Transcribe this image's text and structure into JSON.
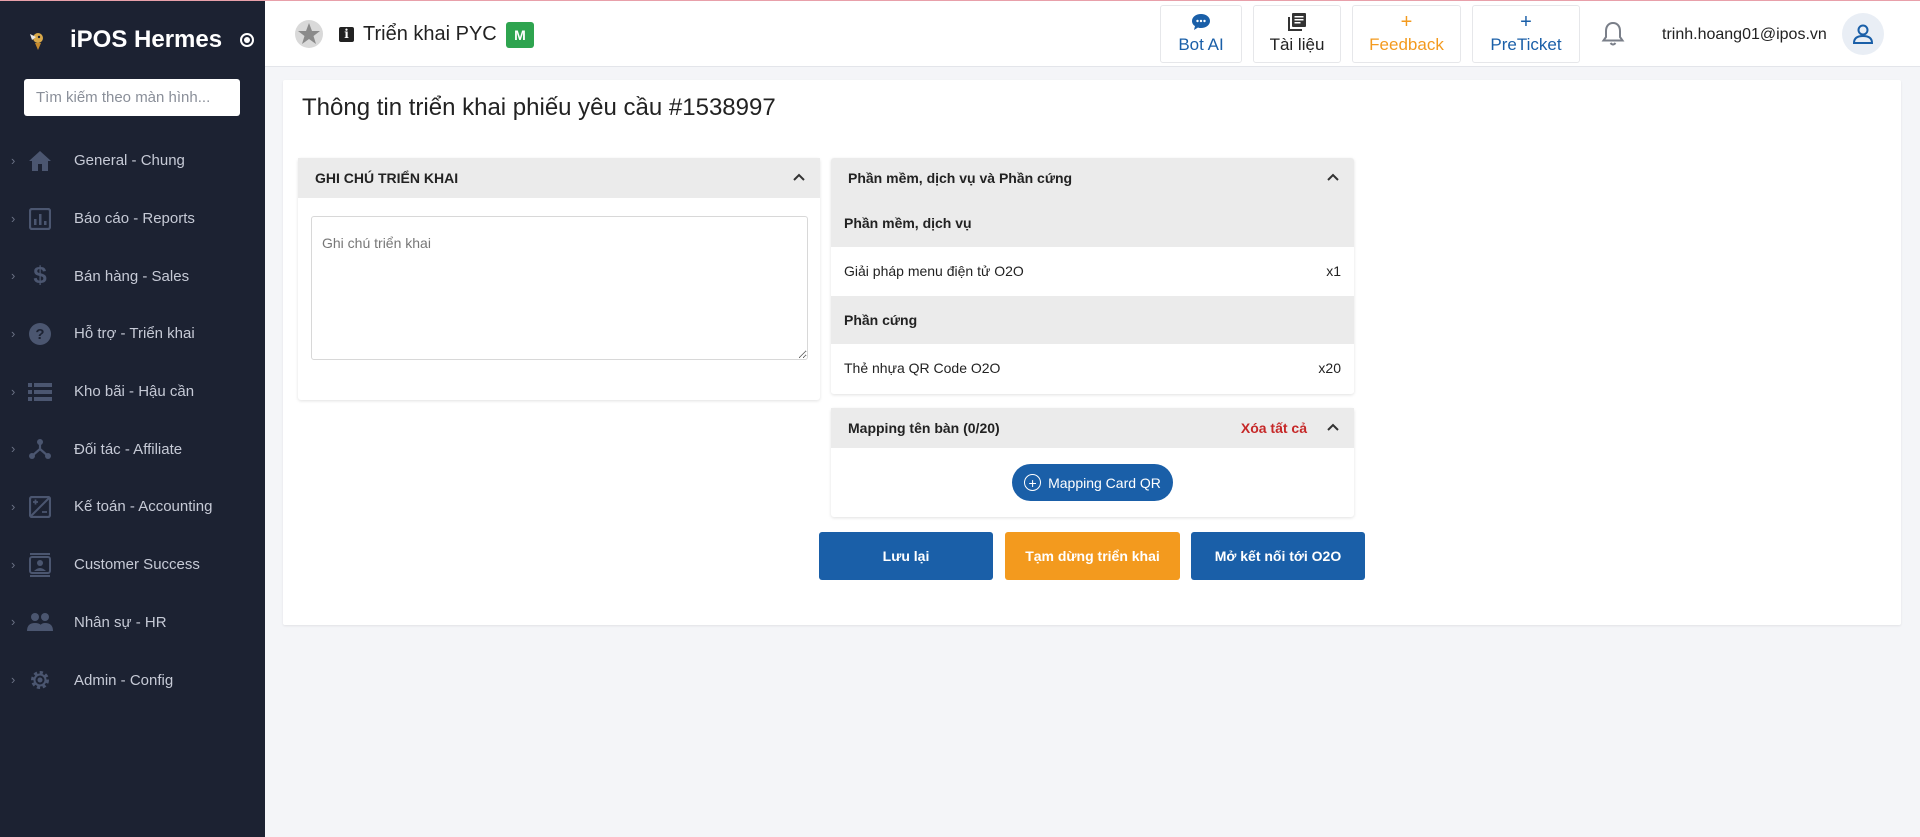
{
  "sidebar": {
    "brand": "iPOS Hermes",
    "search_placeholder": "Tìm kiếm theo màn hình...",
    "items": [
      {
        "label": "General - Chung",
        "icon": "home-icon"
      },
      {
        "label": "Báo cáo - Reports",
        "icon": "report-chart-icon"
      },
      {
        "label": "Bán hàng - Sales",
        "icon": "dollar-icon"
      },
      {
        "label": "Hỗ trợ - Triển khai",
        "icon": "help-circle-icon"
      },
      {
        "label": "Kho bãi - Hậu cần",
        "icon": "list-stack-icon"
      },
      {
        "label": "Đối tác - Affiliate",
        "icon": "network-hub-icon"
      },
      {
        "label": "Kế toán - Accounting",
        "icon": "calculator-icon"
      },
      {
        "label": "Customer Success",
        "icon": "contacts-icon"
      },
      {
        "label": "Nhân sự - HR",
        "icon": "people-icon"
      },
      {
        "label": "Admin - Config",
        "icon": "gear-icon"
      }
    ]
  },
  "header": {
    "title": "Triển khai PYC",
    "badge": "M",
    "buttons": {
      "bot_ai": "Bot AI",
      "tai_lieu": "Tài liệu",
      "feedback": "Feedback",
      "preticket": "PreTicket"
    },
    "user_email": "trinh.hoang01@ipos.vn"
  },
  "page": {
    "title": "Thông tin triển khai phiếu yêu cầu #1538997"
  },
  "notes_panel": {
    "title": "GHI CHÚ TRIỂN KHAI",
    "placeholder": "Ghi chú triển khai"
  },
  "products_panel": {
    "title": "Phần mềm, dịch vụ và Phần cứng",
    "software_heading": "Phần mềm, dịch vụ",
    "software_items": [
      {
        "name": "Giải pháp menu điện tử O2O",
        "qty": "x1"
      }
    ],
    "hardware_heading": "Phần cứng",
    "hardware_items": [
      {
        "name": "Thẻ nhựa QR Code O2O",
        "qty": "x20"
      }
    ]
  },
  "mapping_panel": {
    "title": "Mapping tên bàn (0/20)",
    "clear_all": "Xóa tất cả",
    "button": "Mapping Card QR"
  },
  "actions": {
    "save": "Lưu lại",
    "pause": "Tạm dừng triển khai",
    "open_o2o": "Mở kết nối tới O2O"
  },
  "colors": {
    "sidebar_bg": "#1c2232",
    "primary_blue": "#1a5fa8",
    "accent_orange": "#f39a1e",
    "danger_red": "#c62828",
    "badge_green": "#2ea44f"
  }
}
